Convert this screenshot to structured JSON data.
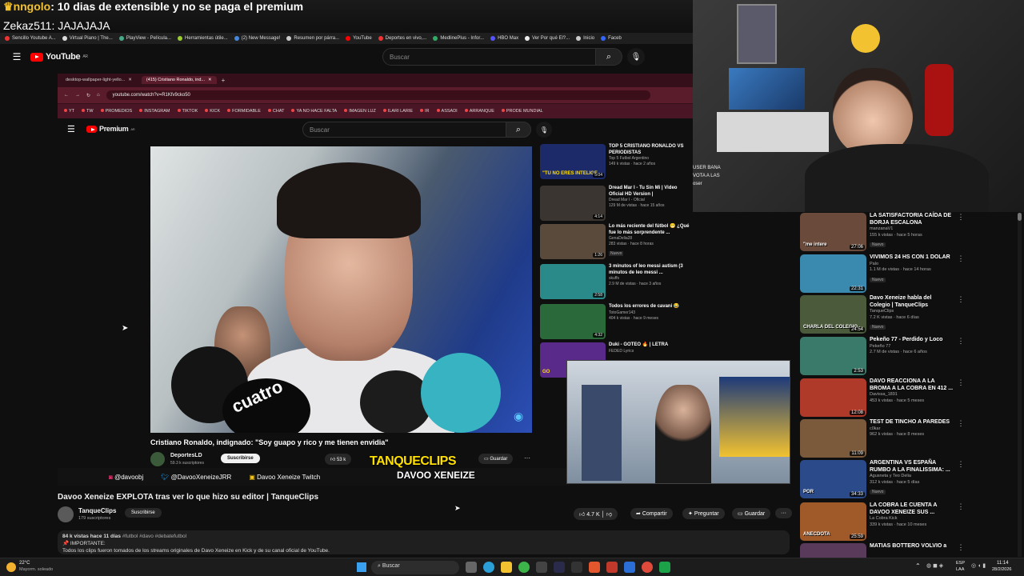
{
  "chat": {
    "line1_user": "nngolo",
    "line1_text": ": 10 dias de extensible y no se paga el premium",
    "line2": "Zekaz511: JAJAJAJA"
  },
  "bookmarks": [
    {
      "label": "Sencillo Youtube A...",
      "color": "#e33"
    },
    {
      "label": "Virtual Piano | The...",
      "color": "#ddd"
    },
    {
      "label": "PlayView - Película...",
      "color": "#4a8"
    },
    {
      "label": "Herramientas útile...",
      "color": "#9c3"
    },
    {
      "label": "(2) New Message!",
      "color": "#48d"
    },
    {
      "label": "Resumen por párra...",
      "color": "#ccc"
    },
    {
      "label": "YouTube",
      "color": "#f00"
    },
    {
      "label": "Deportes en vivo,...",
      "color": "#e33"
    },
    {
      "label": "MedlinePlus - Infor...",
      "color": "#3a6"
    },
    {
      "label": "HBO Max",
      "color": "#55f"
    },
    {
      "label": "Ver Por qué El?...",
      "color": "#eee"
    },
    {
      "label": "Inicio",
      "color": "#ccc"
    },
    {
      "label": "Faceb",
      "color": "#36f"
    }
  ],
  "yt_header": {
    "logo": "YouTube",
    "country": "AR",
    "search_placeholder": "Buscar"
  },
  "inner_browser": {
    "tab1": "desktop-wallpaper-light-yello...",
    "tab2": "(415) Cristiano Ronaldo, ind...",
    "new_tab": "+",
    "url": "youtube.com/watch?v=R1Kfv9cko50",
    "bookmarks": [
      "YT",
      "TW",
      "PROMEDIOS",
      "INSTAGRAM",
      "TIKTOK",
      "KICK",
      "FORMIDABLE",
      "CHAT",
      "YA NO HACE FALTA",
      "IMAGEN LUZ",
      "ILARI LARIE",
      "IR",
      "ASSADI",
      "ARRANQUE",
      "PRODE MUNDIAL"
    ]
  },
  "inner_yt": {
    "logo": "Premium",
    "country": "AR",
    "search_placeholder": "Buscar",
    "video_overlay": "cuatro",
    "video_title": "Cristiano Ronaldo, indignado: \"Soy guapo y rico y me tienen envidia\"",
    "channel": "DeportesLD",
    "subs": "59.3 k suscriptores",
    "subscribe": "Suscribirse",
    "likes": "53 k",
    "save": "Guardar"
  },
  "inner_recs": [
    {
      "title": "TOP 5 CRISTIANO RONALDO VS PERIODISTAS",
      "channel": "Top 5 Futbol Argentino",
      "meta": "149 k vistas · hace 2 años",
      "thumb_text": "\"TU NO ERES INTELIGE",
      "dur": "5:04",
      "color": "#1d2a6a"
    },
    {
      "title": "Dread Mar I - Tu Sin Mi | Video Oficial HD Version |",
      "channel": "Dread Mar I - Oficial",
      "meta": "129 M de vistas · hace 15 años",
      "thumb_text": "",
      "dur": "4:14",
      "color": "#3a3530"
    },
    {
      "title": "Lo más reciente del fútbol 😁 ¿Qué fue lo más sorprendente ...",
      "channel": "GenaDelia28",
      "meta": "283 vistas · hace 8 horas",
      "badge": "Nuevo",
      "thumb_text": "",
      "dur": "1:26",
      "color": "#5a4a3c"
    },
    {
      "title": "3 minutos of leo messi autism (3 minutos de leo messi ...",
      "channel": "skuffs",
      "meta": "2.9 M de vistas · hace 3 años",
      "thumb_text": "",
      "dur": "2:58",
      "color": "#2a8a8a"
    },
    {
      "title": "Todos los errores de cavani 😂",
      "channel": "TotoGamer143",
      "meta": "404 k vistas · hace 9 meses",
      "thumb_text": "",
      "dur": "4:32",
      "color": "#2a6a3a"
    },
    {
      "title": "Duki - GOTEO 🔥 | LETRA",
      "channel": "FEDED Lyrics",
      "meta": "",
      "thumb_text": "GO",
      "dur": "",
      "color": "#5a2a8a"
    }
  ],
  "social": {
    "instagram": "@davoobj",
    "twitter": "@DavooXeneizeJRR",
    "twitch": "Davoo Xeneize Twitch"
  },
  "overlay": {
    "brand": "TANQUECLIPS",
    "sub": "DAVOO XENEIZE"
  },
  "cam_overlay": {
    "text1": "USER BANA",
    "text2": "VOTA A LAS",
    "text3": "oser"
  },
  "outer_video": {
    "title": "Davoo Xeneize EXPLOTA tras ver lo que hizo su editor | TanqueClips",
    "channel": "TanqueClips",
    "subs": "179 suscriptores",
    "subscribe": "Suscribirse",
    "likes": "4.7 K",
    "share": "Compartir",
    "ask": "Preguntar",
    "save": "Guardar",
    "more": "···",
    "desc_meta": "84 k vistas  hace 11 días",
    "desc_tags": "#futbol #davo #debatefutbol",
    "desc_important": "📌 IMPORTANTE:",
    "desc_line": "Todos los clips fueron tomados de los streams originales de Davo Xeneize en Kick y de su canal oficial de YouTube."
  },
  "outer_recs": [
    {
      "title": "LA SATISFACTORIA CAÍDA DE BORJA ESCALONA",
      "channel": "manzanaV1",
      "meta": "155 k vistas · hace 5 horas",
      "badge": "Nuevo",
      "thumb_text": "\"me intere",
      "dur": "27:06",
      "color": "#6a4a3a"
    },
    {
      "title": "VIVIMOS 24 HS CON 1 DOLAR",
      "channel": "Palo",
      "meta": "1.1 M de vistas · hace 14 horas",
      "badge": "Nuevo",
      "thumb_text": "",
      "dur": "22:31",
      "color": "#3a8ab0"
    },
    {
      "title": "Davo Xeneize habla del Colegio | TanqueClips",
      "channel": "TanqueClips",
      "meta": "7.2 K vistas · hace 6 días",
      "badge": "Nuevo",
      "thumb_text": "CHARLA DEL COLEGIO",
      "dur": "24:54",
      "color": "#4a5a3a"
    },
    {
      "title": "Pekeño 77 - Perdido y Loco",
      "channel": "Pekeño 77",
      "meta": "2.7 M de vistas · hace 6 años",
      "badge": "",
      "thumb_text": "",
      "dur": "2:53",
      "color": "#3a7a6a"
    },
    {
      "title": "DAVO REACCIONA A LA BROMA A LA COBRA EN 412 ...",
      "channel": "Davissa_1891",
      "meta": "453 k vistas · hace 5 meses",
      "badge": "",
      "thumb_text": "",
      "dur": "12:08",
      "color": "#b03a2a"
    },
    {
      "title": "TEST DE TINCHO A PAREDES",
      "channel": "c0kar",
      "meta": "962 k vistas · hace 8 meses",
      "badge": "",
      "thumb_text": "",
      "dur": "11:09",
      "color": "#7a5a3a"
    },
    {
      "title": "ARGENTINA VS ESPAÑA RUMBO A LA FINALISSIMA: ...",
      "channel": "Agusneta y Teo Delia",
      "meta": "312 k vistas · hace 5 días",
      "badge": "Nuevo",
      "thumb_text": "POR",
      "dur": "34:33",
      "color": "#2a4a8a"
    },
    {
      "title": "LA COBRA LE CUENTA A DAVOO XENEIZE SUS ...",
      "channel": "La Cobra Kick",
      "meta": "339 k vistas · hace 10 meses",
      "badge": "",
      "thumb_text": "ANECDOTA",
      "dur": "25:59",
      "color": "#a05a2a"
    },
    {
      "title": "MATIAS BOTTERO VOLVIO a",
      "channel": "",
      "meta": "",
      "badge": "",
      "thumb_text": "",
      "dur": "",
      "color": "#5a3a5a"
    }
  ],
  "taskbar": {
    "weather_temp": "22°C",
    "weather_desc": "Mayorm. soleado",
    "search": "Buscar",
    "lang1": "ESP",
    "lang2": "LAA",
    "time": "11:14",
    "date": "28/2/2026"
  }
}
